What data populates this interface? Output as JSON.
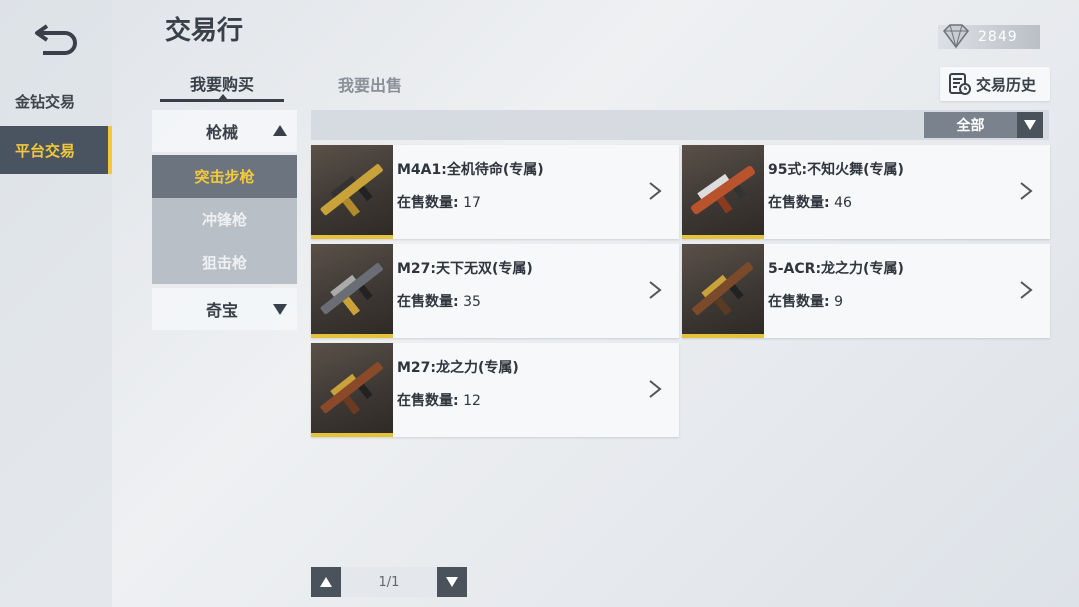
{
  "header": {
    "title": "交易行",
    "currency_value": "2849"
  },
  "sidebar": {
    "items": [
      {
        "label": "金钻交易",
        "active": false
      },
      {
        "label": "平台交易",
        "active": true
      }
    ]
  },
  "tabs": [
    {
      "label": "我要购买",
      "active": true
    },
    {
      "label": "我要出售",
      "active": false
    }
  ],
  "toolbar": {
    "history_label": "交易历史"
  },
  "categories": {
    "guns_label": "枪械",
    "subcategories": [
      {
        "label": "突击步枪",
        "active": true
      },
      {
        "label": "冲锋枪",
        "active": false
      },
      {
        "label": "狙击枪",
        "active": false
      }
    ],
    "treasure_label": "奇宝"
  },
  "filter": {
    "selected": "全部"
  },
  "qty_label": "在售数量:",
  "items": [
    {
      "name": "M4A1:全机待命(专属)",
      "qty": "17"
    },
    {
      "name": "95式:不知火舞(专属)",
      "qty": "46"
    },
    {
      "name": "M27:天下无双(专属)",
      "qty": "35"
    },
    {
      "name": "5-ACR:龙之力(专属)",
      "qty": "9"
    },
    {
      "name": "M27:龙之力(专属)",
      "qty": "12"
    }
  ],
  "pagination": {
    "text": "1/1"
  },
  "colors": {
    "accent": "#f2c93b",
    "dark": "#4a525c",
    "rarity_bar": "#e6c23a"
  },
  "icons": {
    "back": "back-arrow-icon",
    "currency": "diamond-icon",
    "history": "history-list-icon",
    "chevron": "chevron-right-icon"
  }
}
